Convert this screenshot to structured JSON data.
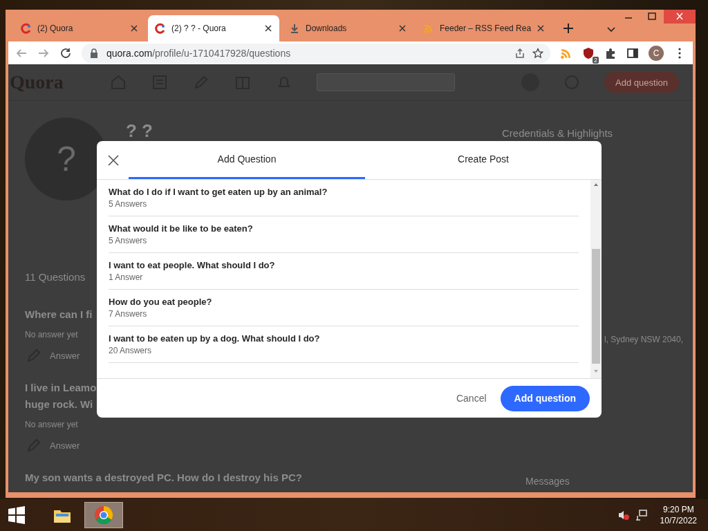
{
  "browser": {
    "tabs": [
      {
        "title": "(2) Quora",
        "kind": "quora",
        "selected": false
      },
      {
        "title": "(2) ? ? - Quora",
        "kind": "quora",
        "selected": true
      },
      {
        "title": "Downloads",
        "kind": "download",
        "selected": false
      },
      {
        "title": "Feeder – RSS Feed Rea",
        "kind": "feed",
        "selected": false
      }
    ],
    "url_host": "quora.com",
    "url_path": "/profile/u-1710417928/questions",
    "extension_badge": "2",
    "profile_initial": "C"
  },
  "page": {
    "logo": "Quora",
    "header_button": "Add question",
    "profile_name": "? ?",
    "avatar_mark": "?",
    "questions_count": "11 Questions",
    "questions": [
      {
        "title": "Where can I fi",
        "status": "No answer yet",
        "action": "Answer"
      },
      {
        "title": "I live in Leamo",
        "title_line_2": "huge rock. Wi",
        "status": "No answer yet",
        "action": "Answer"
      },
      {
        "title": "My son wants a destroyed PC. How do I destroy his PC?"
      }
    ],
    "sidebar": {
      "heading": "Credentials & Highlights",
      "address": "l, Sydney NSW 2040,",
      "messages": "Messages"
    }
  },
  "modal": {
    "tabs": [
      {
        "label": "Add Question",
        "selected": true
      },
      {
        "label": "Create Post",
        "selected": false
      }
    ],
    "questions": [
      {
        "title": "What do I do if I want to get eaten up by an animal?",
        "answers": "5 Answers"
      },
      {
        "title": "What would it be like to be eaten?",
        "answers": "5 Answers"
      },
      {
        "title": "I want to eat people. What should I do?",
        "answers": "1 Answer"
      },
      {
        "title": "How do you eat people?",
        "answers": "7 Answers"
      },
      {
        "title": "I want to be eaten up by a dog. What should I do?",
        "answers": "20 Answers"
      }
    ],
    "cancel": "Cancel",
    "submit": "Add question"
  },
  "taskbar": {
    "apps": [
      {
        "kind": "folder",
        "selected": false
      },
      {
        "kind": "chrome",
        "selected": true
      }
    ],
    "time": "9:20 PM",
    "date": "10/7/2022"
  }
}
